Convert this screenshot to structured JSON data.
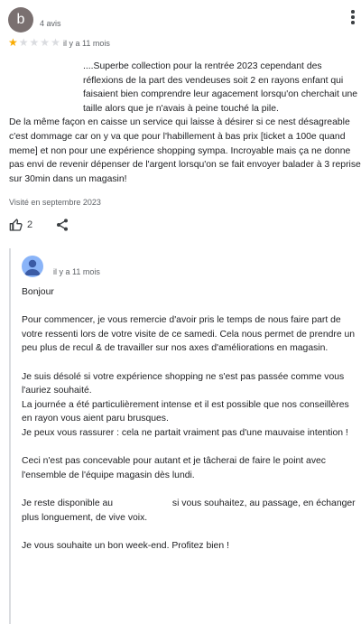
{
  "review": {
    "avatar_letter": "b",
    "reviewer_meta": "4 avis",
    "rating": 1,
    "rating_max": 5,
    "date": "il y a 11 mois",
    "text_lines_1": "....Superbe collection pour la rentrée 2023 cependant des réflexions de la part des vendeuses soit 2 en rayons enfant qui faisaient bien comprendre leur agacement lorsqu'on cherchait une taille alors que je n'avais à peine touché la pile.",
    "text_lines_2": "De la même façon en caisse un service qui laisse à désirer si ce nest désagreable c'est dommage car on y va que pour l'habillement à bas prix [ticket a 100e quand meme] et non pour une expérience shopping sympa. Incroyable mais ça ne donne pas envi de revenir dépenser de l'argent lorsqu'on se fait envoyer balader à 3 reprise sur 30min dans un magasin!",
    "visited": "Visité en septembre 2023",
    "likes": "2"
  },
  "reply": {
    "date": "il y a 11 mois",
    "greeting": "Bonjour",
    "p1": "Pour commencer, je vous remercie d'avoir pris le temps de nous faire part de votre ressenti lors de votre visite de ce samedi. Cela nous permet de prendre un peu plus de recul & de travailler sur nos axes d'améliorations en magasin.",
    "p2a": "Je suis désolé si votre expérience shopping ne s'est pas passée comme vous l'auriez souhaité.",
    "p2b": "La journée a été particulièrement intense et il est possible que nos conseillères en rayon vous aient paru brusques.",
    "p2c": "Je peux vous rassurer : cela ne partait vraiment pas d'une mauvaise intention !",
    "p3": "Ceci n'est pas concevable pour autant et je tâcherai de faire le point avec l'ensemble de l'équipe magasin dès lundi.",
    "p4_start": "Je reste disponible au",
    "p4_end": "si vous souhaitez, au passage, en échanger plus longuement, de vive voix.",
    "p5": "Je vous souhaite un bon week-end. Profitez bien !"
  },
  "colors": {
    "star_on": "#f9ab00",
    "star_off": "#dadce0",
    "avatar": "#7a7070",
    "owner_avatar": "#8ab4f8"
  },
  "icons": [
    "more-vert-icon",
    "star-icon",
    "thumb-up-icon",
    "share-icon",
    "owner-avatar-icon"
  ]
}
